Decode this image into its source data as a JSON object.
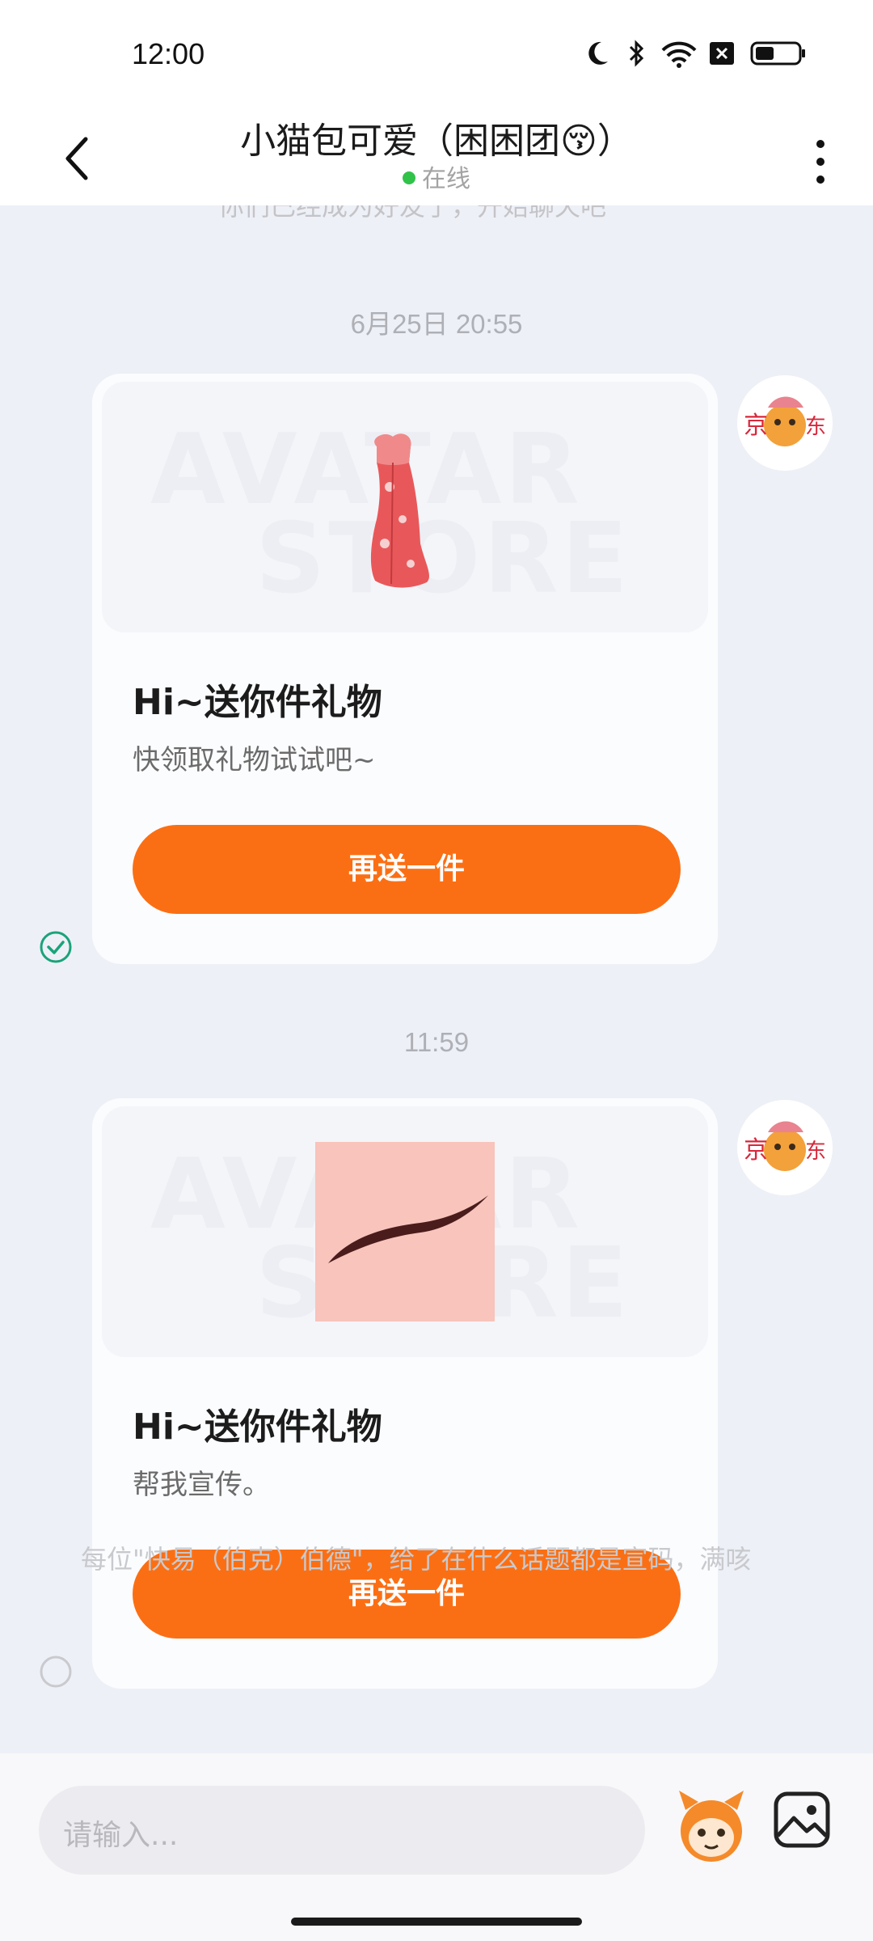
{
  "status_bar": {
    "time": "12:00",
    "icons": [
      "moon-icon",
      "bluetooth-icon",
      "wifi-icon",
      "sim-off-icon",
      "battery-icon"
    ]
  },
  "header": {
    "title": "小猫包可爱（困困团😚）",
    "status": "在线",
    "status_color": "#31c24a"
  },
  "chat": {
    "cut_top_text": "你们已经成为好友了，开始聊天吧",
    "messages": [
      {
        "timestamp": "6月25日 20:55",
        "card": {
          "watermark_1": "AVATAR",
          "watermark_2": "STORE",
          "title": "Hi~送你件礼物",
          "desc": "快领取礼物试试吧~",
          "button": "再送一件"
        },
        "delivery_status": "read"
      },
      {
        "timestamp": "11:59",
        "card": {
          "watermark_1": "AVATAR",
          "watermark_2": "STORE",
          "title": "Hi~送你件礼物",
          "desc": "帮我宣传。",
          "button": "再送一件"
        },
        "delivery_status": "pending"
      }
    ],
    "cut_bottom_text": "每位\"快易（伯克）伯德\"，给了在什么话题都是宣码，满咳"
  },
  "input_bar": {
    "placeholder": "请输入..."
  },
  "colors": {
    "accent": "#fb6f14",
    "background": "#eef0f7",
    "check": "#1aa37a"
  }
}
